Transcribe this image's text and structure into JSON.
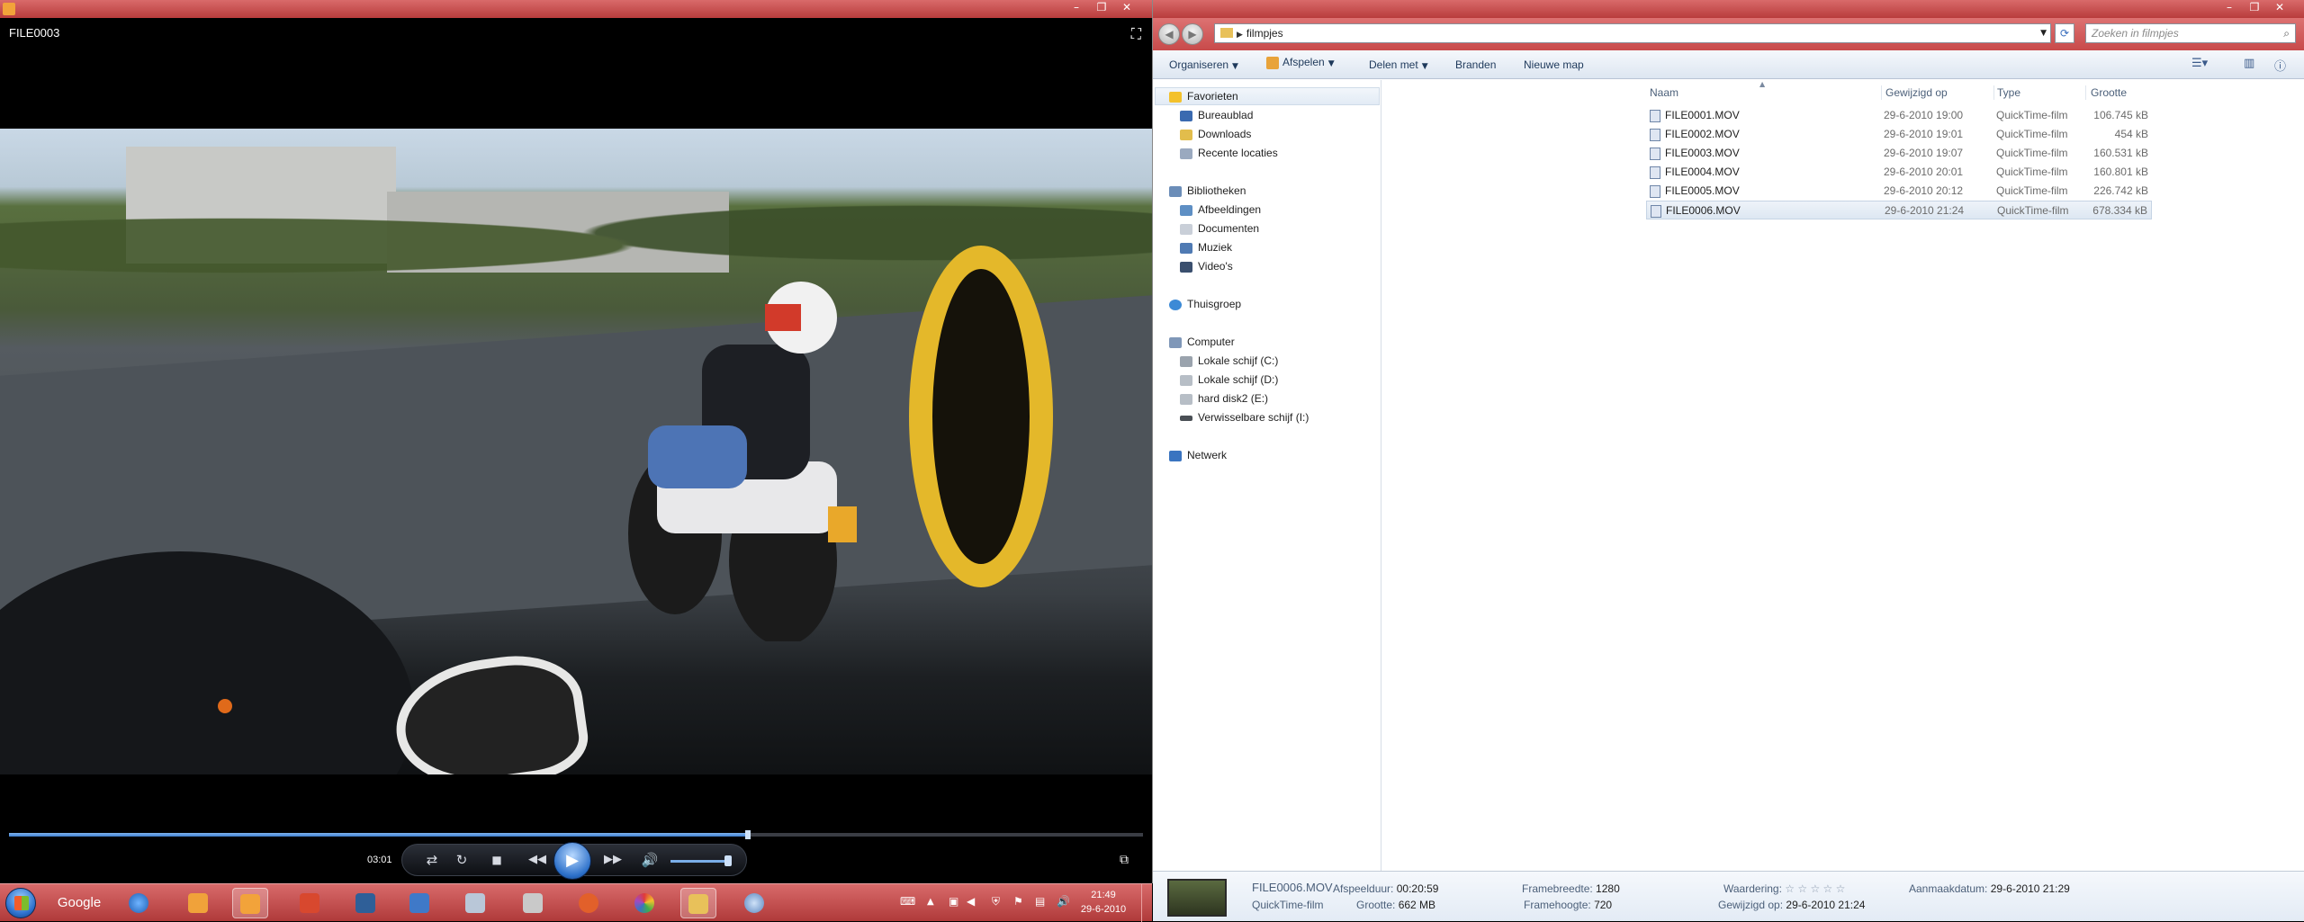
{
  "player": {
    "title": "FILE0003",
    "time": "03:01",
    "progress_fraction": 0.65,
    "icons": {
      "fullscreen": "fullscreen-toggle-icon",
      "shuffle": "shuffle-icon",
      "repeat": "repeat-icon",
      "stop": "stop-icon",
      "previous": "previous-icon",
      "play": "play-icon",
      "next": "next-icon",
      "mute": "volume-icon",
      "switch_view": "switch-to-library-icon"
    }
  },
  "explorer": {
    "address": {
      "current_folder": "filmpjes"
    },
    "search_placeholder": "Zoeken in filmpjes",
    "toolbar": {
      "organize": "Organiseren",
      "play": "Afspelen",
      "share": "Delen met",
      "burn": "Branden",
      "new_folder": "Nieuwe map"
    },
    "nav": {
      "favorites": "Favorieten",
      "desktop": "Bureaublad",
      "downloads": "Downloads",
      "recent": "Recente locaties",
      "libraries": "Bibliotheken",
      "pictures": "Afbeeldingen",
      "documents": "Documenten",
      "music": "Muziek",
      "videos": "Video's",
      "homegroup": "Thuisgroep",
      "computer": "Computer",
      "drive_c": "Lokale schijf (C:)",
      "drive_d": "Lokale schijf (D:)",
      "drive_e": "hard disk2 (E:)",
      "drive_i": "Verwisselbare schijf (I:)",
      "network": "Netwerk"
    },
    "columns": {
      "name": "Naam",
      "modified": "Gewijzigd op",
      "type": "Type",
      "size": "Grootte"
    },
    "files": [
      {
        "name": "FILE0001.MOV",
        "modified": "29-6-2010 19:00",
        "type": "QuickTime-film",
        "size": "106.745 kB"
      },
      {
        "name": "FILE0002.MOV",
        "modified": "29-6-2010 19:01",
        "type": "QuickTime-film",
        "size": "454 kB"
      },
      {
        "name": "FILE0003.MOV",
        "modified": "29-6-2010 19:07",
        "type": "QuickTime-film",
        "size": "160.531 kB"
      },
      {
        "name": "FILE0004.MOV",
        "modified": "29-6-2010 20:01",
        "type": "QuickTime-film",
        "size": "160.801 kB"
      },
      {
        "name": "FILE0005.MOV",
        "modified": "29-6-2010 20:12",
        "type": "QuickTime-film",
        "size": "226.742 kB"
      },
      {
        "name": "FILE0006.MOV",
        "modified": "29-6-2010 21:24",
        "type": "QuickTime-film",
        "size": "678.334 kB"
      }
    ],
    "details": {
      "filename": "FILE0006.MOV",
      "filetype": "QuickTime-film",
      "duration_label": "Afspeelduur:",
      "duration": "00:20:59",
      "size_label": "Grootte:",
      "size": "662 MB",
      "framewidth_label": "Framebreedte:",
      "framewidth": "1280",
      "frameheight_label": "Framehoogte:",
      "frameheight": "720",
      "rating_label": "Waardering:",
      "rating_stars": "☆ ☆ ☆ ☆ ☆",
      "modified_label": "Gewijzigd op:",
      "modified": "29-6-2010 21:24",
      "created_label": "Aanmaakdatum:",
      "created": "29-6-2010 21:29"
    }
  },
  "taskbar": {
    "google_label": "Google",
    "clock_time": "21:49",
    "clock_date": "29-6-2010"
  },
  "colors": {
    "titlebar": "#c84a4a",
    "taskbar": "#b03a3a",
    "seek_fill": "#3f7fcf",
    "selection": "#dde7f2"
  }
}
